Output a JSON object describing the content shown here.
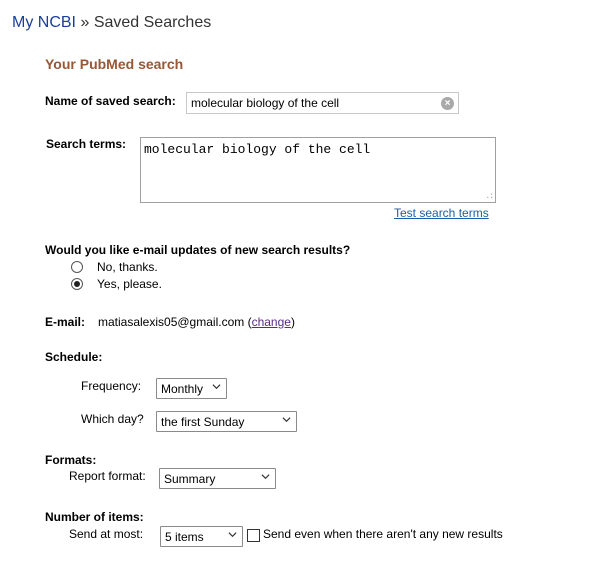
{
  "breadcrumb": {
    "root": "My NCBI",
    "separator": "»",
    "current": "Saved Searches"
  },
  "section_title": "Your PubMed search",
  "name_field": {
    "label": "Name of saved search:",
    "value": "molecular biology of the cell"
  },
  "search_terms": {
    "label": "Search terms:",
    "value": "molecular biology of the cell",
    "test_link": "Test search terms"
  },
  "email_updates": {
    "question": "Would you like e-mail updates of new search results?",
    "options": [
      {
        "label": "No, thanks.",
        "selected": false
      },
      {
        "label": "Yes, please.",
        "selected": true
      }
    ]
  },
  "email": {
    "label": "E-mail:",
    "address": "matiasalexis05@gmail.com",
    "open_paren": "(",
    "change_link": "change",
    "close_paren": ")"
  },
  "schedule": {
    "label": "Schedule:",
    "frequency_label": "Frequency:",
    "frequency_value": "Monthly",
    "day_label": "Which day?",
    "day_value": "the first Sunday"
  },
  "formats": {
    "label": "Formats:",
    "report_label": "Report format:",
    "report_value": "Summary"
  },
  "items": {
    "label": "Number of items:",
    "send_label": "Send at most:",
    "send_value": "5 items",
    "checkbox_label": "Send even when there aren't any new results",
    "checkbox_checked": false
  }
}
